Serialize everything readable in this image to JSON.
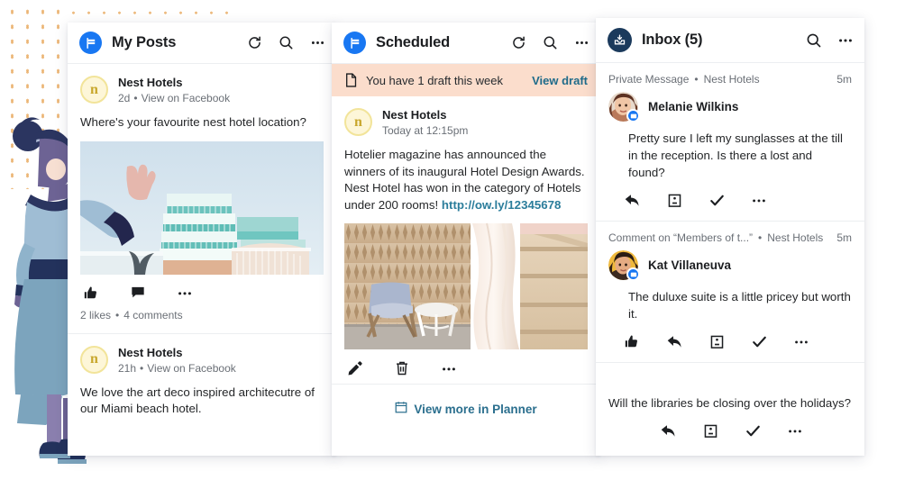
{
  "theme": {
    "accent_blue": "#1877f2",
    "inbox_navy": "#1b3a5c",
    "link_teal": "#2b7d9b",
    "banner_peach": "#fbddcc",
    "dot_orange": "#e8a85c",
    "nest_gold": "#c8a72c"
  },
  "my_posts": {
    "title": "My Posts",
    "brand_icon": "facebook-flag-icon",
    "actions": [
      {
        "name": "refresh-icon",
        "label": "Refresh"
      },
      {
        "name": "search-icon",
        "label": "Search"
      },
      {
        "name": "more-options-icon",
        "label": "More options"
      }
    ],
    "posts": [
      {
        "avatar_letter": "n",
        "author": "Nest Hotels",
        "time": "2d",
        "separator": "•",
        "source_link": "View on Facebook",
        "body": "Where's your favourite nest hotel location?",
        "image_alt": "art-deco-hotel-building-photo",
        "actions": [
          {
            "name": "like-icon",
            "label": "Like"
          },
          {
            "name": "comment-icon",
            "label": "Comment"
          },
          {
            "name": "more-options-icon",
            "label": "More options"
          }
        ],
        "likes": "2 likes",
        "stat_separator": "•",
        "comments": "4 comments"
      },
      {
        "avatar_letter": "n",
        "author": "Nest Hotels",
        "time": "21h",
        "separator": "•",
        "source_link": "View on Facebook",
        "body": "We love the art deco inspired architecutre of our Miami beach hotel."
      }
    ]
  },
  "scheduled": {
    "title": "Scheduled",
    "brand_icon": "facebook-flag-icon",
    "actions": [
      {
        "name": "refresh-icon",
        "label": "Refresh"
      },
      {
        "name": "search-icon",
        "label": "Search"
      },
      {
        "name": "more-options-icon",
        "label": "More options"
      }
    ],
    "draft_banner": {
      "icon": "document-icon",
      "text": "You have 1 draft this week",
      "link": "View draft"
    },
    "post": {
      "avatar_letter": "n",
      "author": "Nest Hotels",
      "time": "Today at 12:15pm",
      "body_text": "Hotelier magazine has announced the winners of its inaugural Hotel Design Awards. Nest Hotel has won in the category of Hotels under 200 rooms! ",
      "body_link": "http://ow.ly/12345678",
      "image_alt": "hotel-interior-chair-and-curtain-photo",
      "actions": [
        {
          "name": "edit-pencil-icon",
          "label": "Edit"
        },
        {
          "name": "delete-trash-icon",
          "label": "Delete"
        },
        {
          "name": "more-options-icon",
          "label": "More options"
        }
      ]
    },
    "footer": {
      "icon": "calendar-icon",
      "label": "View more in Planner"
    }
  },
  "inbox": {
    "title": "Inbox (5)",
    "brand_icon": "inbox-tray-icon",
    "actions": [
      {
        "name": "search-icon",
        "label": "Search"
      },
      {
        "name": "more-options-icon",
        "label": "More options"
      }
    ],
    "items": [
      {
        "type": "Private Message",
        "separator": "•",
        "account": "Nest Hotels",
        "time": "5m",
        "sender": "Melanie Wilkins",
        "avatar_alt": "melanie-wilkins-avatar",
        "badge_icon": "messenger-badge-icon",
        "message": "Pretty sure I left my sunglasses at the till in the reception. Is there a lost and found?",
        "actions": [
          {
            "name": "reply-icon",
            "label": "Reply"
          },
          {
            "name": "assign-icon",
            "label": "Assign"
          },
          {
            "name": "resolve-check-icon",
            "label": "Mark complete"
          },
          {
            "name": "more-options-icon",
            "label": "More options"
          }
        ]
      },
      {
        "type": "Comment on “Members of t...”",
        "separator": "•",
        "account": "Nest Hotels",
        "time": "5m",
        "sender": "Kat Villaneuva",
        "avatar_alt": "kat-villaneuva-avatar",
        "badge_icon": "messenger-badge-icon",
        "message": "The duluxe suite is a little pricey but worth it.",
        "actions": [
          {
            "name": "like-icon",
            "label": "Like"
          },
          {
            "name": "reply-icon",
            "label": "Reply"
          },
          {
            "name": "assign-icon",
            "label": "Assign"
          },
          {
            "name": "resolve-check-icon",
            "label": "Mark complete"
          },
          {
            "name": "more-options-icon",
            "label": "More options"
          }
        ]
      },
      {
        "message": "Will the libraries be closing over the holidays?",
        "actions": [
          {
            "name": "reply-icon",
            "label": "Reply"
          },
          {
            "name": "assign-icon",
            "label": "Assign"
          },
          {
            "name": "resolve-check-icon",
            "label": "Mark complete"
          },
          {
            "name": "more-options-icon",
            "label": "More options"
          }
        ]
      }
    ]
  }
}
